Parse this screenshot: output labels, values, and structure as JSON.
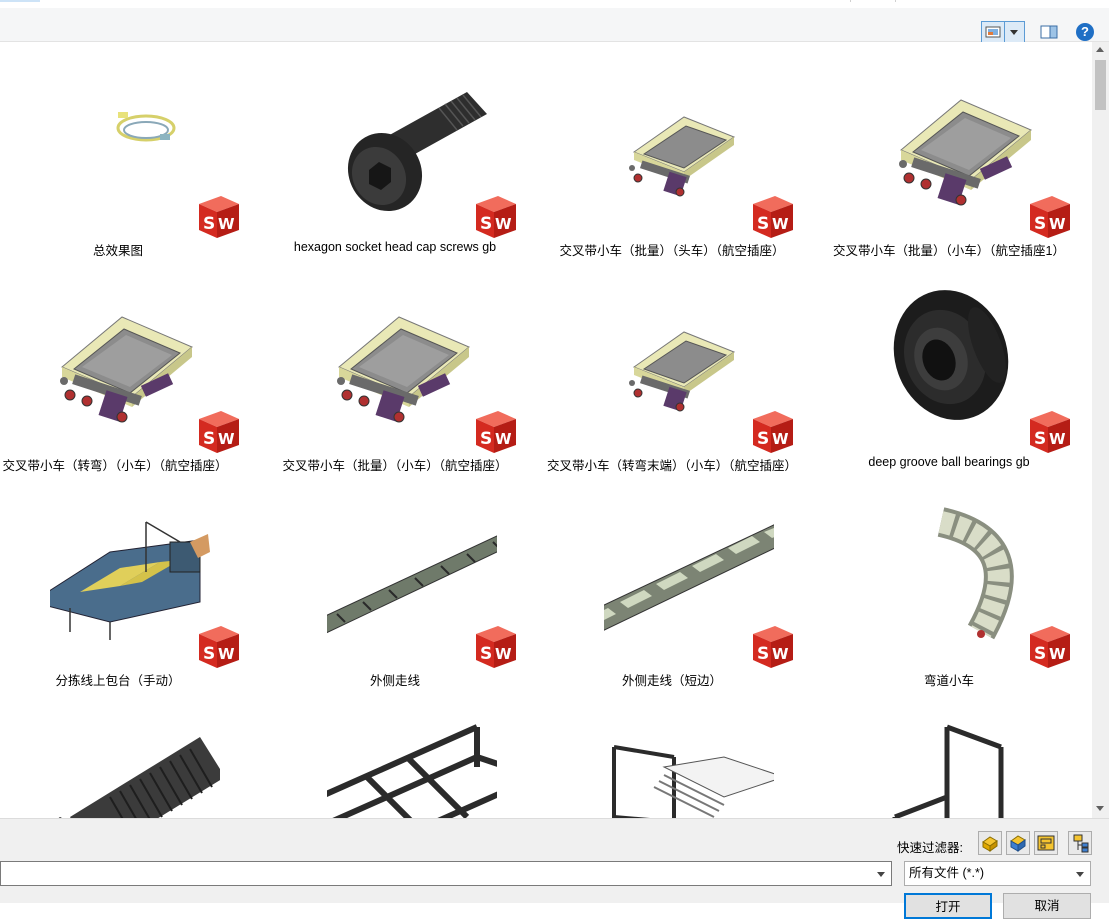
{
  "toolbar": {
    "view_button_icon": "thumbnail-view-icon",
    "view_dropdown_icon": "chevron-down-icon",
    "preview_icon": "preview-pane-icon",
    "help_label": "?"
  },
  "files": [
    {
      "label": "总效果图",
      "thumb": "overview-assembly",
      "badge": "SW"
    },
    {
      "label": "hexagon socket head cap screws gb",
      "thumb": "cap-screw",
      "badge": "SW"
    },
    {
      "label": "交叉带小车（批量）（头车）（航空插座）",
      "thumb": "cart-small",
      "badge": "SW"
    },
    {
      "label": "交叉带小车（批量）（小车）（航空插座1）",
      "thumb": "cart-large",
      "badge": "SW"
    },
    {
      "label": "交叉带小车（转弯）（小车）（航空插座）",
      "thumb": "cart-large",
      "badge": "SW"
    },
    {
      "label": "交叉带小车（批量）（小车）（航空插座）",
      "thumb": "cart-large",
      "badge": "SW"
    },
    {
      "label": "交叉带小车（转弯末端）（小车）（航空插座）",
      "thumb": "cart-small",
      "badge": "SW"
    },
    {
      "label": "deep groove ball bearings gb",
      "thumb": "bearing",
      "badge": "SW"
    },
    {
      "label": "分拣线上包台（手动）",
      "thumb": "induction-table",
      "badge": "SW"
    },
    {
      "label": "外侧走线",
      "thumb": "track-long",
      "badge": "SW"
    },
    {
      "label": "外侧走线（短边）",
      "thumb": "track-short",
      "badge": "SW"
    },
    {
      "label": "弯道小车",
      "thumb": "curve-cart",
      "badge": "SW"
    },
    {
      "label": "",
      "thumb": "screw-thread",
      "badge": ""
    },
    {
      "label": "",
      "thumb": "frame-long",
      "badge": ""
    },
    {
      "label": "",
      "thumb": "frame-box",
      "badge": ""
    },
    {
      "label": "",
      "thumb": "frame-tall",
      "badge": ""
    }
  ],
  "bottom": {
    "quick_filter_label": "快速过滤器:",
    "quick_filters": [
      "filter-parts-icon",
      "filter-assemblies-icon",
      "filter-drawings-icon",
      "filter-top-level-icon"
    ],
    "filename_value": "",
    "filetype_value": "所有文件 (*.*)",
    "open_label": "打开",
    "cancel_label": "取消"
  },
  "colors": {
    "sw_red": "#d42a20",
    "accent": "#0078d7",
    "cart_tray": "#8a8a8a",
    "cart_wing": "#e8e8b0",
    "cart_frame": "#5a3a6a"
  }
}
